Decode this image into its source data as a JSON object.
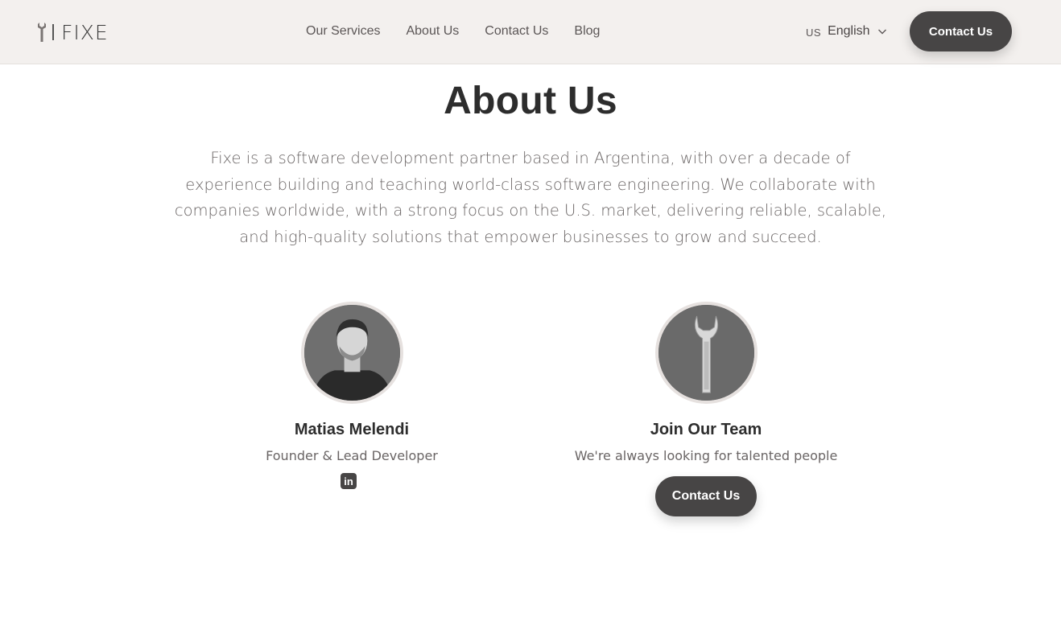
{
  "header": {
    "logo_text": "FIXE",
    "nav": [
      "Our Services",
      "About Us",
      "Contact Us",
      "Blog"
    ],
    "language": {
      "code": "US",
      "name": "English"
    },
    "cta_label": "Contact Us"
  },
  "main": {
    "title": "About Us",
    "intro_lines": [
      "Fixe is a software development partner based in Argentina, with over a decade of",
      "experience building and teaching world-class software engineering. We collaborate with",
      "companies worldwide, with a strong focus on the U.S. market, delivering reliable, scalable,",
      "and high-quality solutions that empower businesses to grow and succeed."
    ]
  },
  "team": [
    {
      "name": "Matias Melendi",
      "role": "Founder & Lead Developer",
      "social_icon": "linkedin-icon",
      "social_text": "in"
    },
    {
      "name": "Join Our Team",
      "role": "We're always looking for talented people",
      "cta_label": "Contact Us"
    }
  ],
  "colors": {
    "header_bg": "#f3f0ee",
    "button_bg": "#474545",
    "text_dark": "#2d2d2d",
    "text_muted": "#6a6565"
  }
}
